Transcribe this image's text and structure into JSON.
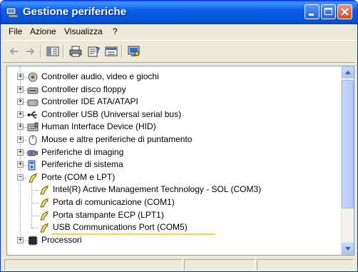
{
  "window": {
    "title": "Gestione periferiche"
  },
  "menu": [
    {
      "label": "File"
    },
    {
      "label": "Azione"
    },
    {
      "label": "Visualizza"
    },
    {
      "label": "?"
    }
  ],
  "tree": {
    "items": [
      {
        "label": "Controller audio, video e giochi",
        "icon": "sound-card-icon",
        "expanded": false
      },
      {
        "label": "Controller disco floppy",
        "icon": "floppy-controller-icon",
        "expanded": false
      },
      {
        "label": "Controller IDE ATA/ATAPI",
        "icon": "ide-controller-icon",
        "expanded": false
      },
      {
        "label": "Controller USB (Universal serial bus)",
        "icon": "usb-icon",
        "expanded": false
      },
      {
        "label": "Human Interface Device (HID)",
        "icon": "hid-icon",
        "expanded": false
      },
      {
        "label": "Mouse e altre periferiche di puntamento",
        "icon": "mouse-icon",
        "expanded": false
      },
      {
        "label": "Periferiche di imaging",
        "icon": "camera-icon",
        "expanded": false
      },
      {
        "label": "Periferiche di sistema",
        "icon": "system-device-icon",
        "expanded": false
      },
      {
        "label": "Porte (COM e LPT)",
        "icon": "port-icon",
        "expanded": true
      },
      {
        "label": "Intel(R) Active Management Technology - SOL (COM3)",
        "icon": "port-icon",
        "child": true
      },
      {
        "label": "Porta di comunicazione (COM1)",
        "icon": "port-icon",
        "child": true
      },
      {
        "label": "Porta stampante ECP (LPT1)",
        "icon": "port-icon",
        "child": true
      },
      {
        "label": "USB Communications Port (COM5)",
        "icon": "port-icon",
        "child": true,
        "highlighted": true
      },
      {
        "label": "Processori",
        "icon": "processor-icon",
        "expanded": false
      }
    ]
  },
  "colors": {
    "titlebar": "#0554d6",
    "highlight_underline": "#f2d640"
  }
}
